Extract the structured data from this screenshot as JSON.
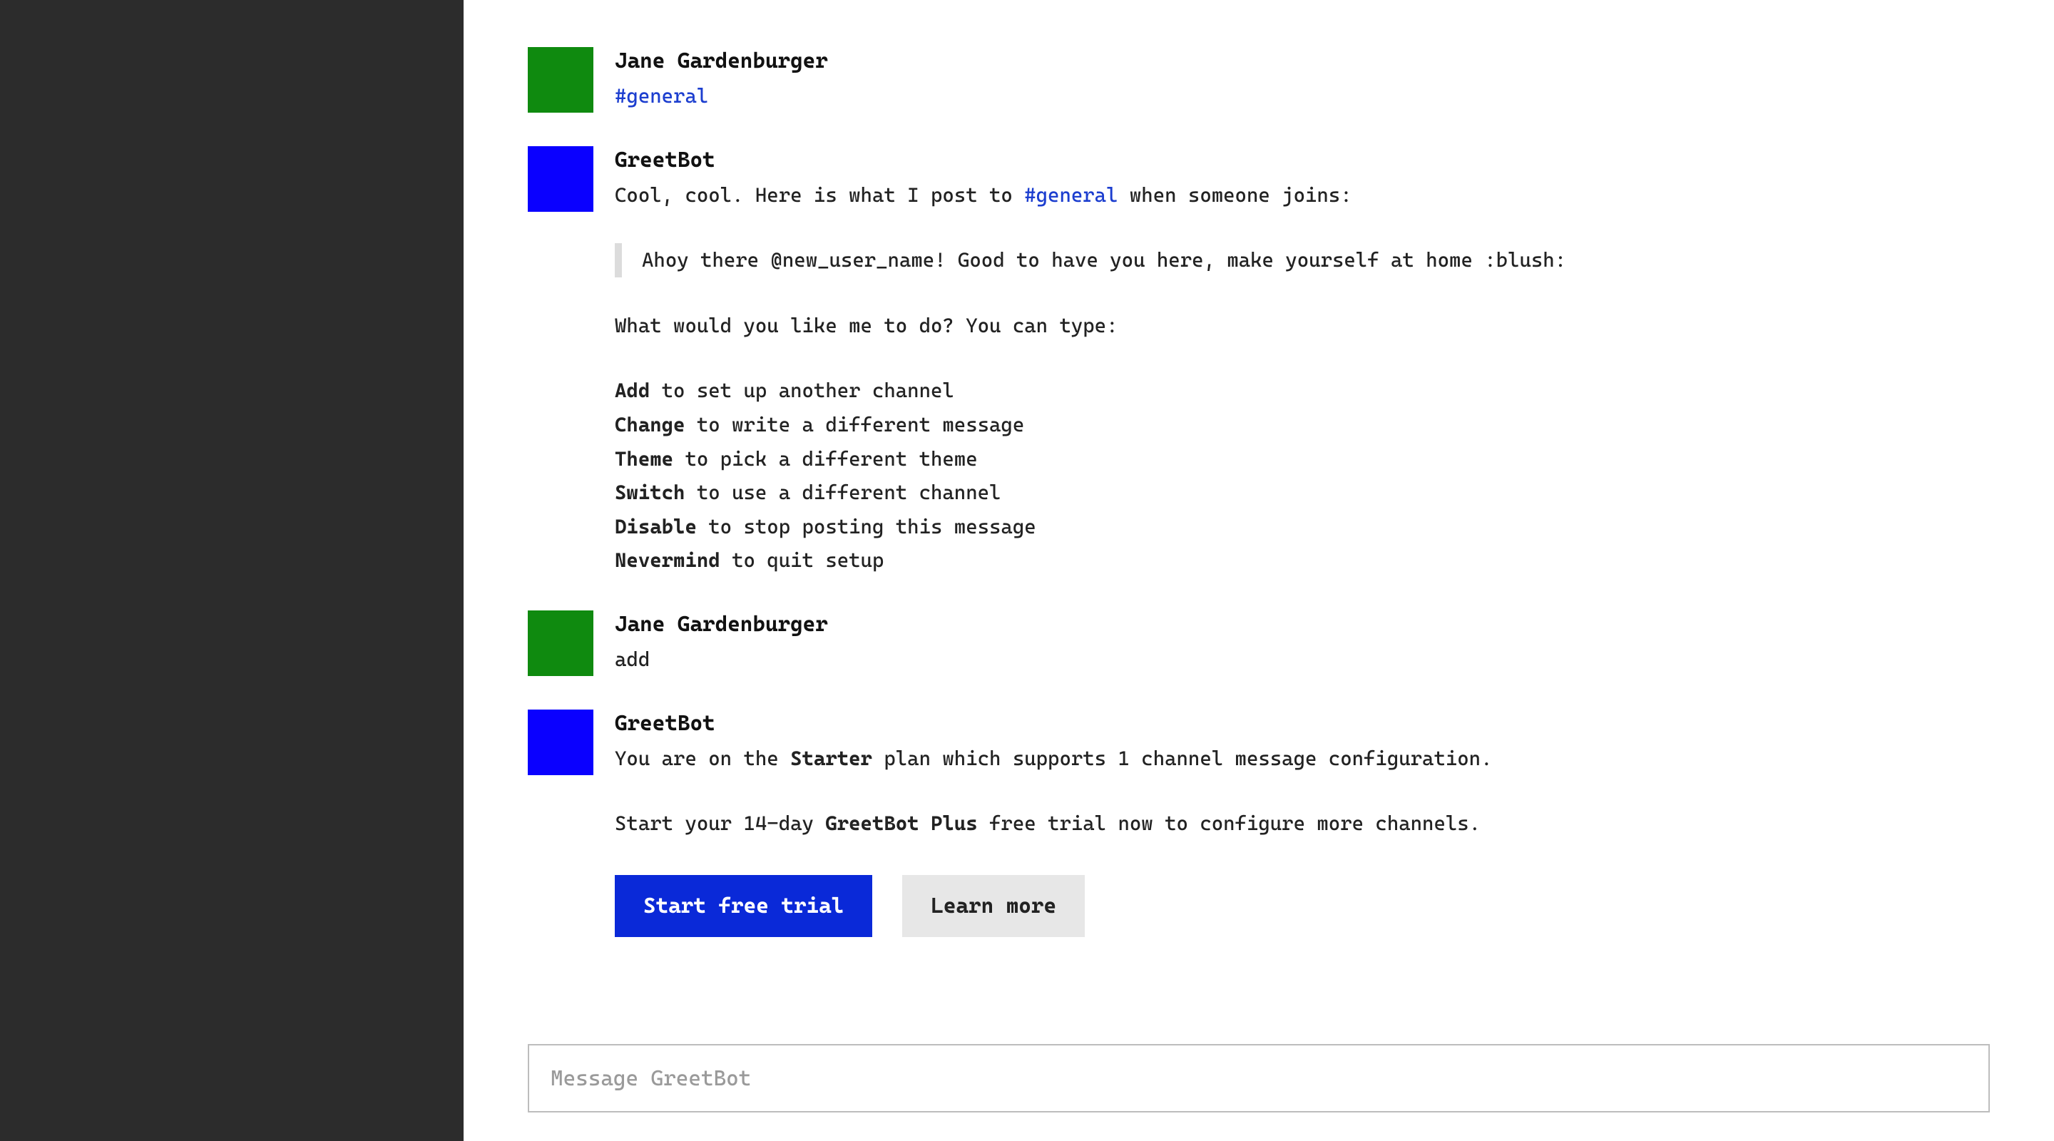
{
  "users": {
    "jane": "Jane Gardenburger",
    "bot": "GreetBot"
  },
  "channel": "#general",
  "msg1": {
    "author": "Jane Gardenburger",
    "text": "#general"
  },
  "msg2": {
    "author": "GreetBot",
    "intro_pre": "Cool, cool. Here is what I post to ",
    "intro_channel": "#general",
    "intro_post": " when someone joins:",
    "quote": "Ahoy there @new_user_name! Good to have you here, make yourself at home :blush:",
    "prompt": "What would you like me to do? You can type:",
    "commands": [
      {
        "cmd": "Add",
        "desc": " to set up another channel"
      },
      {
        "cmd": "Change",
        "desc": " to write a different message"
      },
      {
        "cmd": "Theme",
        "desc": " to pick a different theme"
      },
      {
        "cmd": "Switch",
        "desc": " to use a different channel"
      },
      {
        "cmd": "Disable",
        "desc": " to stop posting this message"
      },
      {
        "cmd": "Nevermind",
        "desc": " to quit setup"
      }
    ]
  },
  "msg3": {
    "author": "Jane Gardenburger",
    "text": "add"
  },
  "msg4": {
    "author": "GreetBot",
    "line1_pre": "You are on the ",
    "line1_bold": "Starter",
    "line1_post": " plan which supports 1 channel message configuration.",
    "line2_pre": "Start your 14-day ",
    "line2_bold": "GreetBot Plus",
    "line2_post": " free trial now to configure more channels."
  },
  "buttons": {
    "start_trial": "Start free trial",
    "learn_more": "Learn more"
  },
  "composer": {
    "placeholder": "Message GreetBot"
  }
}
